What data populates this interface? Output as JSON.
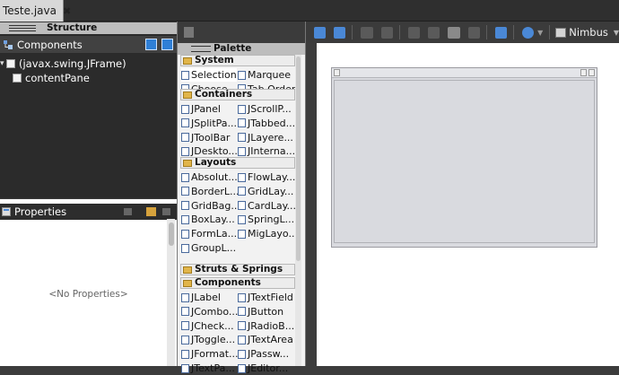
{
  "editor_tab": {
    "title": "Teste.java",
    "close": "✖"
  },
  "structure": {
    "title": "Structure",
    "components_label": "Components",
    "tree": [
      {
        "label": "(javax.swing.JFrame)",
        "toggle": "▾"
      },
      {
        "label": "contentPane"
      }
    ]
  },
  "properties": {
    "title": "Properties",
    "empty": "<No Properties>"
  },
  "palette": {
    "title": "Palette",
    "categories": [
      {
        "label": "System",
        "items": [
          {
            "label": "Selection",
            "icon": "arrow-cursor-icon"
          },
          {
            "label": "Marquee",
            "icon": "marquee-icon"
          },
          {
            "label": "Choose ...",
            "icon": "choose-icon"
          },
          {
            "label": "Tab Order",
            "icon": "tab-order-icon"
          }
        ]
      },
      {
        "label": "Containers",
        "items": [
          {
            "label": "JPanel"
          },
          {
            "label": "JScrollP..."
          },
          {
            "label": "JSplitPa..."
          },
          {
            "label": "JTabbed..."
          },
          {
            "label": "JToolBar"
          },
          {
            "label": "JLayere..."
          },
          {
            "label": "JDeskto..."
          },
          {
            "label": "JInterna..."
          }
        ]
      },
      {
        "label": "Layouts",
        "items": [
          {
            "label": "Absolut..."
          },
          {
            "label": "FlowLay..."
          },
          {
            "label": "BorderL..."
          },
          {
            "label": "GridLay..."
          },
          {
            "label": "GridBag..."
          },
          {
            "label": "CardLay..."
          },
          {
            "label": "BoxLay..."
          },
          {
            "label": "SpringL..."
          },
          {
            "label": "FormLa..."
          },
          {
            "label": "MigLayo..."
          },
          {
            "label": "GroupL..."
          }
        ]
      },
      {
        "label": "Struts & Springs",
        "items": []
      },
      {
        "label": "Components",
        "items": [
          {
            "label": "JLabel"
          },
          {
            "label": "JTextField"
          },
          {
            "label": "JCombo..."
          },
          {
            "label": "JButton"
          },
          {
            "label": "JCheck..."
          },
          {
            "label": "JRadioB..."
          },
          {
            "label": "JToggle..."
          },
          {
            "label": "JTextArea"
          },
          {
            "label": "JFormat..."
          },
          {
            "label": "JPassw..."
          },
          {
            "label": "JTextPa..."
          },
          {
            "label": "JEditor..."
          }
        ]
      }
    ]
  },
  "toolbar": {
    "look_and_feel": "Nimbus",
    "dropdown": "▼"
  },
  "colors": {
    "dark_panel": "#2b2b2b",
    "canvas_frame": "#d9dadf",
    "accent": "#4a88d6"
  }
}
